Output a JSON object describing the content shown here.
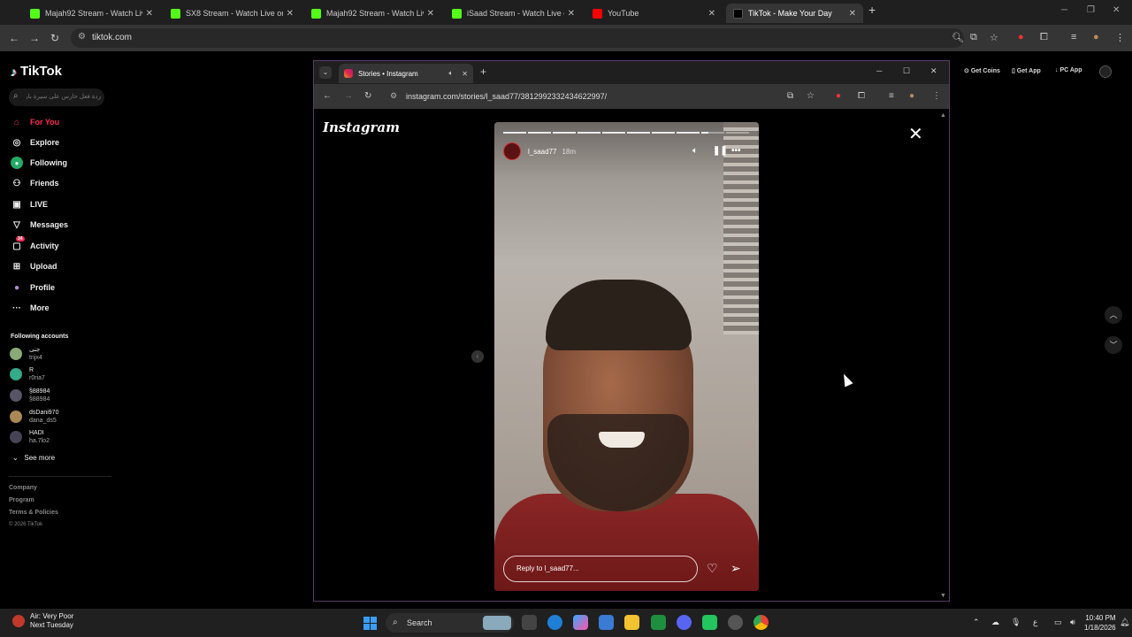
{
  "browser": {
    "tabs": [
      {
        "title": "Majah92 Stream - Watch Live o",
        "color": "#53fc18"
      },
      {
        "title": "SX8 Stream - Watch Live on Ki",
        "color": "#53fc18"
      },
      {
        "title": "Majah92 Stream - Watch Live o",
        "color": "#53fc18"
      },
      {
        "title": "iSaad Stream - Watch Live on K",
        "color": "#53fc18"
      },
      {
        "title": "YouTube",
        "color": "#ff0000"
      },
      {
        "title": "TikTok - Make Your Day",
        "color": "#000000"
      }
    ],
    "address": "tiktok.com"
  },
  "tiktok": {
    "logo": "TikTok",
    "search_placeholder": "ردة فعل حارس على سيرة بارد",
    "nav": [
      {
        "label": "For You",
        "icon": "home-icon"
      },
      {
        "label": "Explore",
        "icon": "compass-icon"
      },
      {
        "label": "Following",
        "icon": "following-icon"
      },
      {
        "label": "Friends",
        "icon": "friends-icon"
      },
      {
        "label": "LIVE",
        "icon": "live-icon"
      },
      {
        "label": "Messages",
        "icon": "messages-icon"
      },
      {
        "label": "Activity",
        "icon": "activity-icon",
        "badge": "34"
      },
      {
        "label": "Upload",
        "icon": "upload-icon"
      },
      {
        "label": "Profile",
        "icon": "profile-icon"
      },
      {
        "label": "More",
        "icon": "more-icon"
      }
    ],
    "following_title": "Following accounts",
    "accounts": [
      {
        "name": "جنى",
        "user": "tnjx4"
      },
      {
        "name": "R",
        "user": "r0ria7"
      },
      {
        "name": "§88984",
        "user": "§88984"
      },
      {
        "name": "dsDani970",
        "user": "dana_ds5"
      },
      {
        "name": "HADI",
        "user": "ha.7lo2"
      }
    ],
    "see_more": "See more",
    "footer": [
      "Company",
      "Program",
      "Terms & Policies",
      "© 2026 TikTok"
    ],
    "top_right": [
      "Get Coins",
      "Get App",
      "PC App"
    ]
  },
  "popup": {
    "tab_title": "Stories • Instagram",
    "url": "instagram.com/stories/l_saad77/3812992332434622997/",
    "logo": "Instagram",
    "story": {
      "username": "l_saad77",
      "time": "18m",
      "reply_placeholder": "Reply to l_saad77...",
      "segments": 10,
      "current_segment": 9
    }
  },
  "taskbar": {
    "weather_title": "Air: Very Poor",
    "weather_sub": "Next Tuesday",
    "search": "Search",
    "time": "10:40 PM",
    "date": "1/18/2026"
  }
}
